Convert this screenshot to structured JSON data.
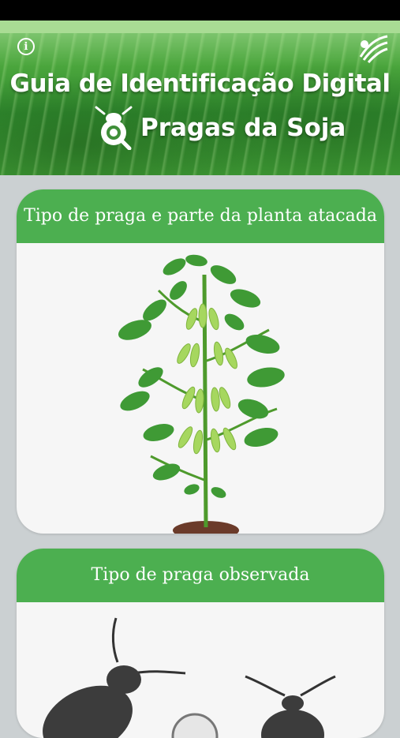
{
  "header": {
    "title_line1": "Guia de Identificação Digital",
    "title_line2": "Pragas da Soja",
    "info_icon": "info-icon",
    "logo_icon": "embrapa-logo-icon"
  },
  "cards": [
    {
      "title": "Tipo de praga e parte da planta atacada",
      "image": "soybean-plant"
    },
    {
      "title": "Tipo de praga observada",
      "image": "insect-silhouettes"
    }
  ],
  "colors": {
    "accent": "#4caf50",
    "card_bg": "#f6f6f6",
    "page_bg": "#cbd0d2"
  }
}
